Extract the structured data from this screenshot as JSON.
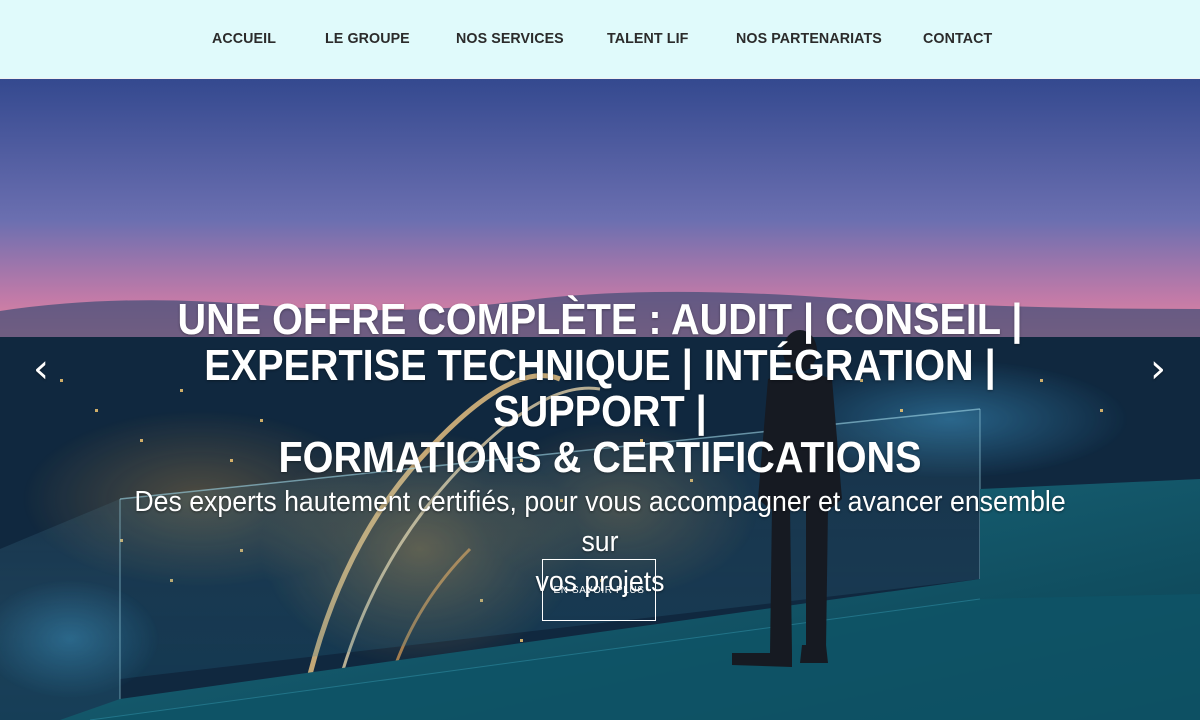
{
  "nav": {
    "items": [
      {
        "label": "ACCUEIL"
      },
      {
        "label": "LE GROUPE"
      },
      {
        "label": "NOS SERVICES"
      },
      {
        "label": "TALENT LIF"
      },
      {
        "label": "NOS PARTENARIATS"
      },
      {
        "label": "CONTACT"
      }
    ]
  },
  "hero": {
    "headline_lines": [
      "UNE OFFRE COMPLÈTE : AUDIT | CONSEIL |",
      "EXPERTISE TECHNIQUE | INTÉGRATION | SUPPORT |",
      "FORMATIONS & CERTIFICATIONS"
    ],
    "subheadline_lines": [
      "Des experts hautement certifiés, pour vous accompagner et avancer ensemble sur",
      "vos projets"
    ],
    "cta_label": "EN SAVOIR PLUS",
    "prev_arrow": "‹",
    "next_arrow": "›"
  },
  "icons": {
    "prev": "chevron-left-icon",
    "next": "chevron-right-icon"
  },
  "colors": {
    "nav_background": "#e0fafb",
    "nav_text": "#2b2b2b",
    "hero_text": "#ffffff",
    "sky_top": "#3b4f9a",
    "sky_mid": "#c77fa6",
    "sky_horizon": "#f08a9a",
    "city_dark": "#0d2438",
    "deck_teal": "#0f4f63"
  }
}
